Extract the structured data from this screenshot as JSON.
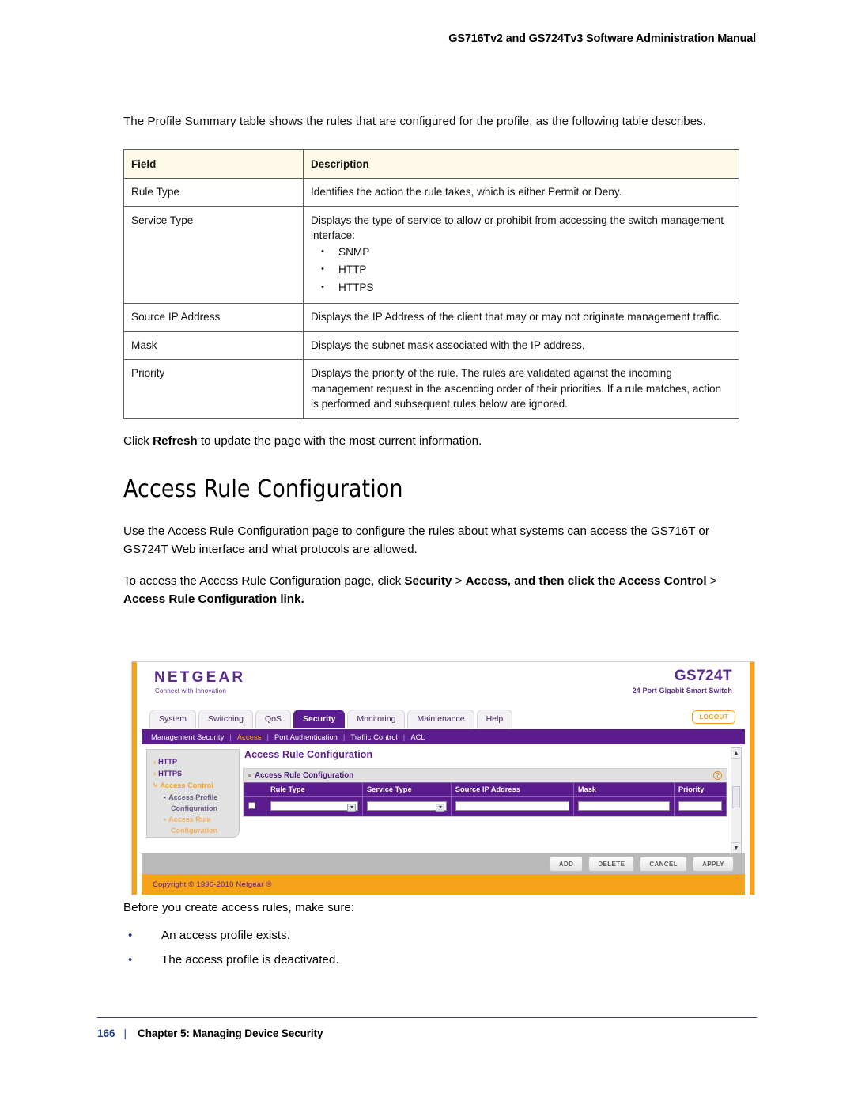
{
  "header": {
    "running_title": "GS716Tv2 and GS724Tv3 Software Administration Manual"
  },
  "intro": {
    "paragraph": "The Profile Summary table shows the rules that are configured for the profile, as the following table describes."
  },
  "desc_table": {
    "columns": [
      "Field",
      "Description"
    ],
    "rows": [
      {
        "field": "Rule Type",
        "description": "Identifies the action the rule takes, which is either Permit or Deny.",
        "bullets": []
      },
      {
        "field": "Service Type",
        "description": "Displays the type of service to allow or prohibit from accessing the switch management interface:",
        "bullets": [
          "SNMP",
          "HTTP",
          "HTTPS"
        ]
      },
      {
        "field": "Source IP Address",
        "description": "Displays the IP Address of the client that may or may not originate management traffic.",
        "bullets": []
      },
      {
        "field": "Mask",
        "description": "Displays the subnet mask associated with the IP address.",
        "bullets": []
      },
      {
        "field": "Priority",
        "description": "Displays the priority of the rule. The rules are validated against the incoming management request in the ascending order of their priorities. If a rule matches, action is performed and subsequent rules below are ignored.",
        "bullets": []
      }
    ]
  },
  "refresh_note": {
    "pre": "Click ",
    "bold": "Refresh",
    "post": " to update the page with the most current information."
  },
  "section": {
    "heading": "Access Rule Configuration",
    "para_use": "Use the Access Rule Configuration page to configure the rules about what systems can access the GS716T or GS724T Web interface and what protocols are allowed.",
    "para_access_pre": "To access the Access Rule Configuration page, click ",
    "para_access_b1": "Security",
    "para_access_gt1": " > ",
    "para_access_b2": "Access, and then click the Access Control",
    "para_access_gt2": " > ",
    "para_access_b3": "Access Rule Configuration link."
  },
  "screenshot": {
    "brand": "NETGEAR",
    "brand_tagline": "Connect with Innovation",
    "model": "GS724T",
    "model_sub": "24 Port Gigabit Smart Switch",
    "logout_label": "LOGOUT",
    "tabs": [
      {
        "label": "System",
        "active": false
      },
      {
        "label": "Switching",
        "active": false
      },
      {
        "label": "QoS",
        "active": false
      },
      {
        "label": "Security",
        "active": true
      },
      {
        "label": "Monitoring",
        "active": false
      },
      {
        "label": "Maintenance",
        "active": false
      },
      {
        "label": "Help",
        "active": false
      }
    ],
    "subnav": [
      {
        "label": "Management Security",
        "active": false
      },
      {
        "label": "Access",
        "active": true
      },
      {
        "label": "Port Authentication",
        "active": false
      },
      {
        "label": "Traffic Control",
        "active": false
      },
      {
        "label": "ACL",
        "active": false
      }
    ],
    "sidebar": {
      "items": [
        {
          "label": "HTTP",
          "marker": "›"
        },
        {
          "label": "HTTPS",
          "marker": "›"
        },
        {
          "label": "Access Control",
          "marker": "˅"
        }
      ],
      "sub_items": [
        {
          "line1": "Access Profile",
          "line2": "Configuration",
          "marker": "▪"
        },
        {
          "line1": "Access Rule",
          "line2": "Configuration",
          "marker": "▪"
        }
      ]
    },
    "page_title": "Access Rule Configuration",
    "panel_title": "Access Rule Configuration",
    "help_glyph": "?",
    "grid": {
      "columns": [
        "Rule Type",
        "Service Type",
        "Source IP Address",
        "Mask",
        "Priority"
      ]
    },
    "buttons": [
      "ADD",
      "DELETE",
      "CANCEL",
      "APPLY"
    ],
    "copyright": "Copyright © 1996-2010 Netgear ®",
    "colors": {
      "purple": "#5b1d8e",
      "orange": "#f5a31a",
      "accent_orange": "#f7a61b"
    }
  },
  "after_figure": {
    "lead": "Before you create access rules, make sure:",
    "bullets": [
      "An access profile exists.",
      "The access profile is deactivated."
    ]
  },
  "page_footer": {
    "page_number": "166",
    "separator": "|",
    "chapter": "Chapter 5:  Managing Device Security"
  }
}
